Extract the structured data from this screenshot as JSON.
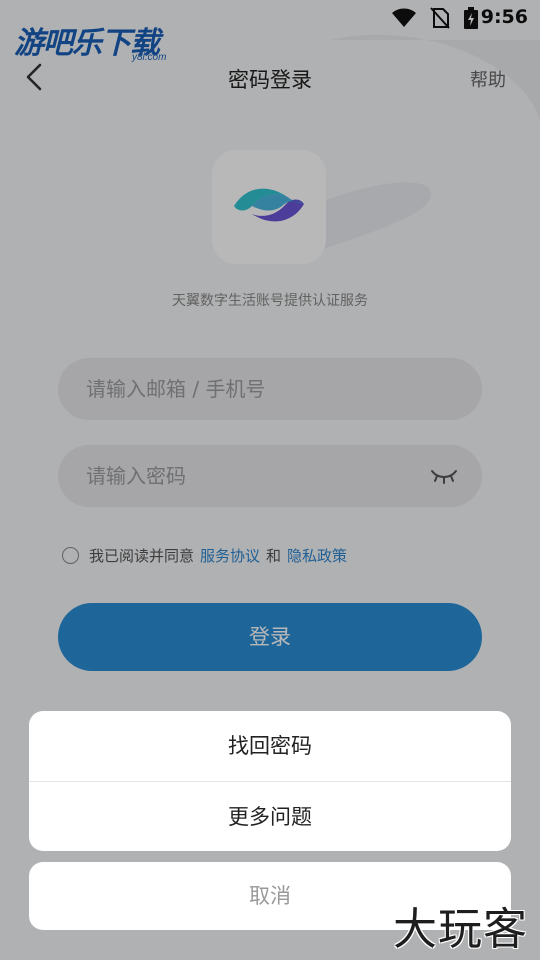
{
  "status_bar": {
    "time": "9:56",
    "icons": [
      "wifi-icon",
      "no-sim-icon",
      "battery-charging-icon"
    ]
  },
  "watermarks": {
    "top_brand": "游吧乐下载",
    "top_sub": "y8l.com",
    "bottom_brand": "大玩客"
  },
  "nav": {
    "back_icon": "chevron-left-icon",
    "title": "密码登录",
    "help": "帮助"
  },
  "logo": {
    "icon": "tianyi-logo-icon",
    "tagline": "天翼数字生活账号提供认证服务"
  },
  "form": {
    "account_placeholder": "请输入邮箱 / 手机号",
    "password_placeholder": "请输入密码",
    "eye_icon": "eye-closed-icon"
  },
  "agreement": {
    "prefix": "我已阅读并同意",
    "service": "服务协议",
    "and": "和",
    "privacy": "隐私政策",
    "checked": false
  },
  "login_button": "登录",
  "action_sheet": {
    "items": [
      "找回密码",
      "更多问题"
    ],
    "cancel": "取消"
  },
  "colors": {
    "accent": "#2a8ed4",
    "link": "#2f86cf",
    "logo_teal": "#32c2cf",
    "logo_purple": "#6a55d6"
  }
}
